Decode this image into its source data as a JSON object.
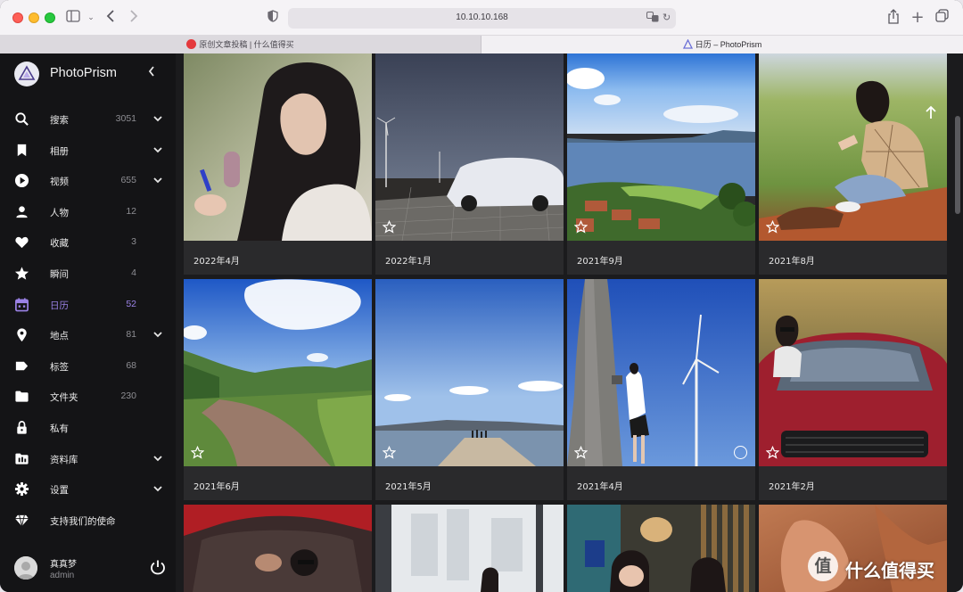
{
  "browser": {
    "url": "10.10.10.168",
    "tabs": [
      {
        "label": "原创文章投稿 | 什么值得买",
        "active": false,
        "favicon_color": "#e4393c"
      },
      {
        "label": "日历 – PhotoPrism",
        "active": true,
        "favicon_color": "#6b6fd6"
      }
    ]
  },
  "app": {
    "name": "PhotoPrism"
  },
  "sidebar": {
    "items": [
      {
        "label": "搜索",
        "count": "3051",
        "icon": "search-icon",
        "expandable": true
      },
      {
        "label": "相册",
        "count": "",
        "icon": "bookmark-icon",
        "expandable": true
      },
      {
        "label": "视频",
        "count": "655",
        "icon": "play-icon",
        "expandable": true
      },
      {
        "label": "人物",
        "count": "12",
        "icon": "person-icon",
        "expandable": false
      },
      {
        "label": "收藏",
        "count": "3",
        "icon": "heart-icon",
        "expandable": false
      },
      {
        "label": "瞬间",
        "count": "4",
        "icon": "star-icon",
        "expandable": false
      },
      {
        "label": "日历",
        "count": "52",
        "icon": "calendar-icon",
        "expandable": false,
        "active": true
      },
      {
        "label": "地点",
        "count": "81",
        "icon": "map-pin-icon",
        "expandable": true
      },
      {
        "label": "标签",
        "count": "68",
        "icon": "tag-icon",
        "expandable": false
      },
      {
        "label": "文件夹",
        "count": "230",
        "icon": "folder-icon",
        "expandable": false
      },
      {
        "label": "私有",
        "count": "",
        "icon": "lock-icon",
        "expandable": false
      },
      {
        "label": "资料库",
        "count": "",
        "icon": "library-icon",
        "expandable": true
      },
      {
        "label": "设置",
        "count": "",
        "icon": "gear-icon",
        "expandable": true
      },
      {
        "label": "支持我们的使命",
        "count": "",
        "icon": "diamond-icon",
        "expandable": false
      }
    ],
    "user": {
      "name": "真真梦",
      "role": "admin"
    }
  },
  "calendar": {
    "months": [
      {
        "label": "2022年4月"
      },
      {
        "label": "2022年1月"
      },
      {
        "label": "2021年9月"
      },
      {
        "label": "2021年8月"
      },
      {
        "label": "2021年6月"
      },
      {
        "label": "2021年5月"
      },
      {
        "label": "2021年4月"
      },
      {
        "label": "2021年2月"
      }
    ]
  },
  "watermark": {
    "logo_text": "值",
    "text": "什么值得买"
  },
  "colors": {
    "accent": "#9b82e6",
    "sidebar_bg": "#141416",
    "card_bg": "#2a2a2c"
  }
}
